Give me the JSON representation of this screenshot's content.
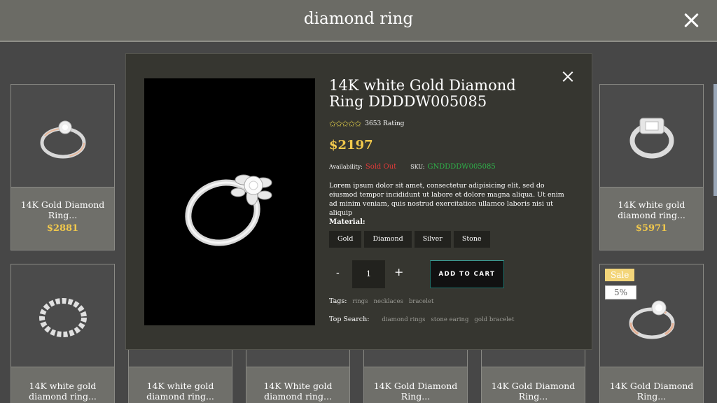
{
  "search": {
    "query": "diamond ring"
  },
  "grid": {
    "row1": [
      {
        "name": "14K Gold Diamond Ring...",
        "price": "$2881"
      },
      {
        "name": "14K white gold diamond ring...",
        "price": "$5971"
      }
    ],
    "row2": [
      {
        "name": "14K white gold diamond ring..."
      },
      {
        "name": "14K white gold diamond ring..."
      },
      {
        "name": "14K White gold diamond ring..."
      },
      {
        "name": "14K Gold Diamond Ring..."
      },
      {
        "name": "14K Gold Diamond Ring..."
      },
      {
        "name": "14K Gold Diamond Ring...",
        "sale": "Sale",
        "discount": "5%"
      }
    ]
  },
  "product": {
    "title": "14K white Gold Diamond Ring DDDDW005085",
    "stars": "✩✩✩✩✩",
    "rating": "3653 Rating",
    "price": "$2197",
    "availability_label": "Availability:",
    "availability_value": "Sold Out",
    "sku_label": "SKU:",
    "sku_value": "GNDDDDW005085",
    "description": "Lorem ipsum dolor sit amet, consectetur adipisicing elit, sed do eiusmod tempor incididunt ut labore et dolore magna aliqua. Ut enim ad minim veniam, quis nostrud exercitation ullamco laboris nisi ut aliquip",
    "material_label": "Material:",
    "materials": [
      "Gold",
      "Diamond",
      "Silver",
      "Stone"
    ],
    "qty_minus": "-",
    "quantity": "1",
    "qty_plus": "+",
    "add_to_cart": "ADD TO CART",
    "tags_label": "Tags:",
    "tags": [
      "rings",
      "necklaces",
      "bracelet"
    ],
    "top_search_label": "Top Search:",
    "top_search": [
      "diamond rings",
      "stone earing",
      "gold bracelet"
    ]
  },
  "colors": {
    "price": "#f2c94c",
    "sold_out": "#e03a3a",
    "sku": "#2fb24a",
    "sale_badge": "#f3d57a"
  }
}
